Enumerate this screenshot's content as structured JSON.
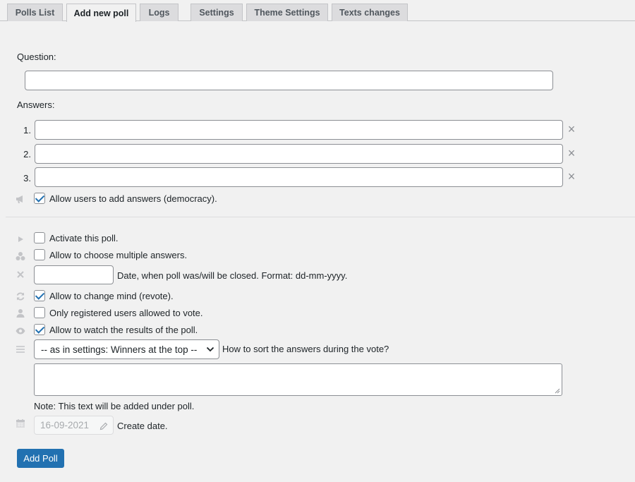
{
  "tabs": [
    {
      "label": "Polls List"
    },
    {
      "label": "Add new poll"
    },
    {
      "label": "Logs"
    },
    {
      "label": "Settings"
    },
    {
      "label": "Theme Settings"
    },
    {
      "label": "Texts changes"
    }
  ],
  "active_tab": "Add new poll",
  "form": {
    "question_label": "Question:",
    "question_value": "",
    "answers_label": "Answers:",
    "answers": [
      {
        "num": "1.",
        "value": ""
      },
      {
        "num": "2.",
        "value": ""
      },
      {
        "num": "3.",
        "value": ""
      }
    ],
    "democracy_label": "Allow users to add answers (democracy).",
    "democracy_checked": true
  },
  "options": {
    "activate_label": "Activate this poll.",
    "activate_checked": false,
    "multiple_label": "Allow to choose multiple answers.",
    "multiple_checked": false,
    "close_date_value": "",
    "close_date_label": "Date, when poll was/will be closed. Format: dd-mm-yyyy.",
    "revote_label": "Allow to change mind (revote).",
    "revote_checked": true,
    "registered_label": "Only registered users allowed to vote.",
    "registered_checked": false,
    "watch_label": "Allow to watch the results of the poll.",
    "watch_checked": true,
    "sort_selected": "-- as in settings: Winners at the top --",
    "sort_label": "How to sort the answers during the vote?",
    "note_value": "",
    "note_label": "Note: This text will be added under poll.",
    "create_date_value": "16-09-2021",
    "create_date_label": "Create date."
  },
  "submit_label": "Add Poll",
  "colors": {
    "accent": "#2271b1",
    "background": "#f1f1f1",
    "icon_muted": "#c3c4c7"
  }
}
